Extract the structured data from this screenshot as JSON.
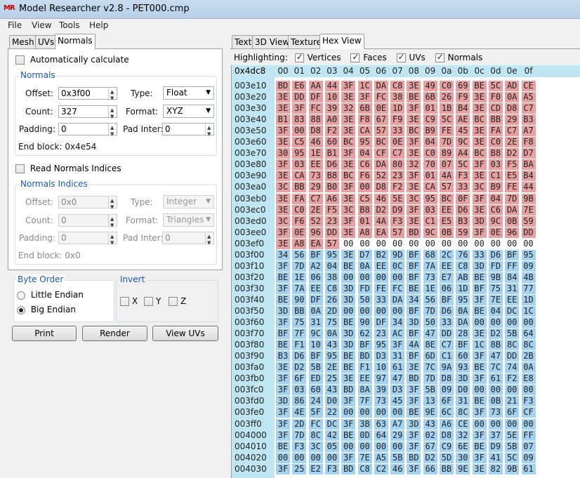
{
  "window": {
    "title": "Model Researcher v2.8 - PET000.cmp",
    "icon": "MR"
  },
  "menu": [
    "File",
    "View",
    "Tools",
    "Help"
  ],
  "left_tabs": [
    {
      "label": "Mesh"
    },
    {
      "label": "UVs"
    },
    {
      "label": "Normals",
      "active": true
    }
  ],
  "normals": {
    "auto_calc": {
      "label": "Automatically calculate",
      "checked": false
    },
    "group_title": "Normals",
    "offset_label": "Offset:",
    "offset_value": "0x3f00",
    "type_label": "Type:",
    "type_value": "Float",
    "count_label": "Count:",
    "count_value": "327",
    "format_label": "Format:",
    "format_value": "XYZ",
    "padding_label": "Padding:",
    "padding_value": "0",
    "pad_inter_label": "Pad Inter:",
    "pad_inter_value": "0",
    "end_block": "End block: 0x4e54"
  },
  "indices": {
    "read_label": "Read Normals Indices",
    "checked": false,
    "group_title": "Normals Indices",
    "offset_label": "Offset:",
    "offset_value": "0x0",
    "type_label": "Type:",
    "type_value": "Integer",
    "count_label": "Count:",
    "count_value": "0",
    "format_label": "Format:",
    "format_value": "Triangles",
    "padding_label": "Padding:",
    "padding_value": "0",
    "pad_inter_label": "Pad Inter:",
    "pad_inter_value": "0",
    "end_block": "End block: 0x0"
  },
  "byte_order": {
    "title": "Byte Order",
    "little": "Little Endian",
    "big": "Big Endian",
    "selected": "big"
  },
  "invert": {
    "title": "Invert",
    "x": "X",
    "y": "Y",
    "z": "Z"
  },
  "buttons": {
    "print": "Print",
    "render": "Render",
    "view_uvs": "View UVs"
  },
  "right_tabs": [
    {
      "label": "Text"
    },
    {
      "label": "3D View"
    },
    {
      "label": "Texture"
    },
    {
      "label": "Hex View",
      "active": true
    }
  ],
  "highlighting": {
    "label": "Highlighting:",
    "vertices": "Vertices",
    "faces": "Faces",
    "uvs": "UVs",
    "normals": "Normals"
  },
  "hex": {
    "corner": "0x4dc8",
    "columns": [
      "00",
      "01",
      "02",
      "03",
      "04",
      "05",
      "06",
      "07",
      "08",
      "09",
      "0a",
      "0b",
      "0c",
      "0d",
      "0e",
      "0f"
    ],
    "colors": {
      "red": "#e8a0a0",
      "blue": "#a3d3f0",
      "header": "#bfe6f2"
    },
    "rows": [
      {
        "addr": "003e10",
        "bytes": [
          "BD",
          "E6",
          "AA",
          "44",
          "3F",
          "1C",
          "DA",
          "C8",
          "3E",
          "49",
          "C0",
          "69",
          "BE",
          "5C",
          "AD",
          "CE"
        ],
        "hl": "rrrrrrrrrrrrrrrr"
      },
      {
        "addr": "003e20",
        "bytes": [
          "3E",
          "DD",
          "DF",
          "10",
          "3E",
          "3F",
          "FC",
          "38",
          "BE",
          "6B",
          "26",
          "F9",
          "3E",
          "F0",
          "0A",
          "A5"
        ],
        "hl": "rrrrrrrrrrrrrrrr"
      },
      {
        "addr": "003e30",
        "bytes": [
          "3E",
          "3F",
          "FC",
          "39",
          "32",
          "6B",
          "0E",
          "1D",
          "3F",
          "01",
          "1B",
          "B4",
          "3E",
          "CD",
          "D8",
          "C7"
        ],
        "hl": "rrrrrrrrrrrrrrrr"
      },
      {
        "addr": "003e40",
        "bytes": [
          "B1",
          "83",
          "88",
          "A0",
          "3E",
          "F8",
          "67",
          "F9",
          "3E",
          "C9",
          "5C",
          "AE",
          "BC",
          "BB",
          "29",
          "B3"
        ],
        "hl": "rrrrrrrrrrrrrrrr"
      },
      {
        "addr": "003e50",
        "bytes": [
          "3F",
          "00",
          "D8",
          "F2",
          "3E",
          "CA",
          "57",
          "33",
          "BC",
          "B9",
          "FE",
          "45",
          "3E",
          "FA",
          "C7",
          "A7"
        ],
        "hl": "rrrrrrrrrrrrrrrr"
      },
      {
        "addr": "003e60",
        "bytes": [
          "3E",
          "C5",
          "46",
          "60",
          "BC",
          "95",
          "BC",
          "0E",
          "3F",
          "04",
          "7D",
          "9C",
          "3E",
          "C0",
          "2E",
          "F8"
        ],
        "hl": "rrrrrrrrrrrrrrrr"
      },
      {
        "addr": "003e70",
        "bytes": [
          "30",
          "95",
          "1E",
          "B1",
          "3F",
          "04",
          "CF",
          "C7",
          "3E",
          "C0",
          "89",
          "A4",
          "BC",
          "B8",
          "D2",
          "D7"
        ],
        "hl": "rrrrrrrrrrrrrrrr"
      },
      {
        "addr": "003e80",
        "bytes": [
          "3F",
          "03",
          "EE",
          "D6",
          "3E",
          "C6",
          "DA",
          "80",
          "32",
          "70",
          "07",
          "5C",
          "3F",
          "03",
          "F5",
          "BA"
        ],
        "hl": "rrrrrrrrrrrrrrrr"
      },
      {
        "addr": "003e90",
        "bytes": [
          "3E",
          "CA",
          "73",
          "B8",
          "BC",
          "F6",
          "52",
          "23",
          "3F",
          "01",
          "4A",
          "F3",
          "3E",
          "C1",
          "E5",
          "B4"
        ],
        "hl": "rrrrrrrrrrrrrrrr"
      },
      {
        "addr": "003ea0",
        "bytes": [
          "3C",
          "BB",
          "29",
          "B0",
          "3F",
          "00",
          "D8",
          "F2",
          "3E",
          "CA",
          "57",
          "33",
          "3C",
          "B9",
          "FE",
          "44"
        ],
        "hl": "rrrrrrrrrrrrrrrr"
      },
      {
        "addr": "003eb0",
        "bytes": [
          "3E",
          "FA",
          "C7",
          "A6",
          "3E",
          "C5",
          "46",
          "5E",
          "3C",
          "95",
          "BC",
          "0F",
          "3F",
          "04",
          "7D",
          "9B"
        ],
        "hl": "rrrrrrrrrrrrrrrr"
      },
      {
        "addr": "003ec0",
        "bytes": [
          "3E",
          "C0",
          "2E",
          "F5",
          "3C",
          "B8",
          "D2",
          "D9",
          "3F",
          "03",
          "EE",
          "D6",
          "3E",
          "C6",
          "DA",
          "7E"
        ],
        "hl": "rrrrrrrrrrrrrrrr"
      },
      {
        "addr": "003ed0",
        "bytes": [
          "3C",
          "F6",
          "52",
          "23",
          "3F",
          "01",
          "4A",
          "F3",
          "3E",
          "C1",
          "E5",
          "B3",
          "3D",
          "9C",
          "0B",
          "59"
        ],
        "hl": "rrrrrrrrrrrrrrrr"
      },
      {
        "addr": "003ee0",
        "bytes": [
          "3F",
          "0E",
          "96",
          "DD",
          "3E",
          "A8",
          "EA",
          "57",
          "BD",
          "9C",
          "0B",
          "59",
          "3F",
          "0E",
          "96",
          "DD"
        ],
        "hl": "rrrrrrrrrrrrrrrr"
      },
      {
        "addr": "003ef0",
        "bytes": [
          "3E",
          "A8",
          "EA",
          "57",
          "00",
          "00",
          "00",
          "00",
          "00",
          "00",
          "00",
          "00",
          "00",
          "00",
          "00",
          "00"
        ],
        "hl": "rrrr............"
      },
      {
        "addr": "003f00",
        "bytes": [
          "34",
          "56",
          "BF",
          "95",
          "3E",
          "D7",
          "B2",
          "9D",
          "BF",
          "68",
          "2C",
          "76",
          "33",
          "D6",
          "BF",
          "95"
        ],
        "hl": "bbbbbbbbbbbbbbbb"
      },
      {
        "addr": "003f10",
        "bytes": [
          "3F",
          "7D",
          "A2",
          "04",
          "BE",
          "0A",
          "EE",
          "0C",
          "BF",
          "7A",
          "EE",
          "C8",
          "3D",
          "FD",
          "FF",
          "09"
        ],
        "hl": "bbbbbbbbbbbbbbbb"
      },
      {
        "addr": "003f20",
        "bytes": [
          "BE",
          "1E",
          "06",
          "38",
          "00",
          "00",
          "00",
          "00",
          "BF",
          "73",
          "E7",
          "AB",
          "BE",
          "9B",
          "84",
          "4B"
        ],
        "hl": "bbbbbbbbbbbbbbbb"
      },
      {
        "addr": "003f30",
        "bytes": [
          "3F",
          "7A",
          "EE",
          "C8",
          "3D",
          "FD",
          "FE",
          "FC",
          "BE",
          "1E",
          "06",
          "1D",
          "BF",
          "75",
          "31",
          "77"
        ],
        "hl": "bbbbbbbbbbbbbbbb"
      },
      {
        "addr": "003f40",
        "bytes": [
          "BE",
          "90",
          "DF",
          "26",
          "3D",
          "50",
          "33",
          "DA",
          "34",
          "56",
          "BF",
          "95",
          "3F",
          "7E",
          "EE",
          "1D"
        ],
        "hl": "bbbbbbbbbbbbbbbb"
      },
      {
        "addr": "003f50",
        "bytes": [
          "3D",
          "BB",
          "0A",
          "2D",
          "00",
          "00",
          "00",
          "00",
          "BF",
          "7D",
          "D6",
          "0A",
          "BE",
          "04",
          "DC",
          "1C"
        ],
        "hl": "bbbbbbbbbbbbbbbb"
      },
      {
        "addr": "003f60",
        "bytes": [
          "3F",
          "75",
          "31",
          "75",
          "BE",
          "90",
          "DF",
          "34",
          "3D",
          "50",
          "33",
          "DA",
          "00",
          "00",
          "00",
          "00"
        ],
        "hl": "bbbbbbbbbbbbbbbb"
      },
      {
        "addr": "003f70",
        "bytes": [
          "BF",
          "7F",
          "9C",
          "0A",
          "3D",
          "62",
          "23",
          "AC",
          "BF",
          "47",
          "DD",
          "28",
          "3E",
          "D2",
          "5B",
          "64"
        ],
        "hl": "bbbbbbbbbbbbbbbb"
      },
      {
        "addr": "003f80",
        "bytes": [
          "BE",
          "F1",
          "10",
          "43",
          "3D",
          "BF",
          "95",
          "3F",
          "4A",
          "8E",
          "C7",
          "BF",
          "1C",
          "8B",
          "8C",
          "8C"
        ],
        "hl": "bbbbbbbbbbbbbbbb"
      },
      {
        "addr": "003f90",
        "bytes": [
          "B3",
          "D6",
          "BF",
          "95",
          "BE",
          "BD",
          "D3",
          "31",
          "BF",
          "6D",
          "C1",
          "60",
          "3F",
          "47",
          "DD",
          "2B"
        ],
        "hl": "bbbbbbbbbbbbbbbb"
      },
      {
        "addr": "003fa0",
        "bytes": [
          "3E",
          "D2",
          "5B",
          "2E",
          "BE",
          "F1",
          "10",
          "61",
          "3E",
          "7C",
          "9A",
          "93",
          "BE",
          "7C",
          "74",
          "0A"
        ],
        "hl": "bbbbbbbbbbbbbbbb"
      },
      {
        "addr": "003fb0",
        "bytes": [
          "3F",
          "6F",
          "ED",
          "25",
          "3E",
          "EE",
          "97",
          "47",
          "BD",
          "7D",
          "D8",
          "3D",
          "3F",
          "61",
          "F2",
          "E8"
        ],
        "hl": "bbbbbbbbbbbbbbbb"
      },
      {
        "addr": "003fc0",
        "bytes": [
          "3F",
          "03",
          "60",
          "43",
          "BD",
          "8A",
          "39",
          "D3",
          "3F",
          "5B",
          "09",
          "D0",
          "00",
          "00",
          "00",
          "00"
        ],
        "hl": "bbbbbbbbbbbbbbbb"
      },
      {
        "addr": "003fd0",
        "bytes": [
          "3D",
          "86",
          "24",
          "D0",
          "3F",
          "7F",
          "73",
          "45",
          "3F",
          "13",
          "6F",
          "31",
          "BE",
          "0B",
          "21",
          "F3"
        ],
        "hl": "bbbbbbbbbbbbbbbb"
      },
      {
        "addr": "003fe0",
        "bytes": [
          "3F",
          "4E",
          "5F",
          "22",
          "00",
          "00",
          "00",
          "00",
          "BE",
          "9E",
          "6C",
          "8C",
          "3F",
          "73",
          "6F",
          "CF"
        ],
        "hl": "bbbbbbbbbbbbbbbb"
      },
      {
        "addr": "003ff0",
        "bytes": [
          "3F",
          "2D",
          "FC",
          "DC",
          "3F",
          "3B",
          "63",
          "A7",
          "3D",
          "43",
          "A6",
          "CE",
          "00",
          "00",
          "00",
          "00"
        ],
        "hl": "bbbbbbbbbbbbbbbb"
      },
      {
        "addr": "004000",
        "bytes": [
          "3F",
          "7D",
          "8C",
          "42",
          "BE",
          "0D",
          "64",
          "29",
          "3F",
          "02",
          "D8",
          "32",
          "3F",
          "37",
          "5E",
          "FF"
        ],
        "hl": "bbbbbbbbbbbbbbbb"
      },
      {
        "addr": "004010",
        "bytes": [
          "BE",
          "F3",
          "3C",
          "05",
          "00",
          "00",
          "00",
          "00",
          "3F",
          "67",
          "C9",
          "6E",
          "BE",
          "D9",
          "5B",
          "07"
        ],
        "hl": "bbbbbbbbbbbbbbbb"
      },
      {
        "addr": "004020",
        "bytes": [
          "00",
          "00",
          "00",
          "00",
          "3F",
          "7E",
          "A5",
          "5B",
          "BD",
          "D2",
          "5D",
          "30",
          "3F",
          "41",
          "5C",
          "09"
        ],
        "hl": "bbbbbbbbbbbbbbbb"
      },
      {
        "addr": "004030",
        "bytes": [
          "3F",
          "25",
          "E2",
          "F3",
          "BD",
          "C8",
          "C2",
          "46",
          "3F",
          "66",
          "BB",
          "9E",
          "3E",
          "82",
          "9B",
          "61"
        ],
        "hl": "bbbbbbbbbbbbbbbb"
      }
    ]
  }
}
